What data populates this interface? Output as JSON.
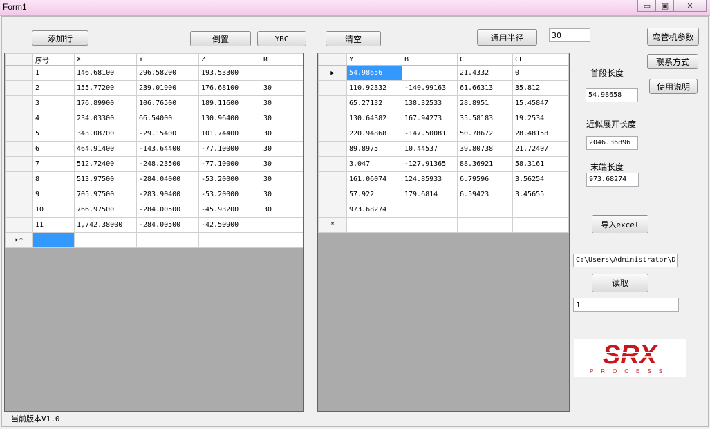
{
  "window": {
    "title": "Form1",
    "minimize": "▭",
    "maximize": "▣",
    "close": "✕"
  },
  "toolbar": {
    "add_row": "添加行",
    "invert": "倒置",
    "ybc": "YBC",
    "clear": "清空",
    "common_radius": "通用半径",
    "radius_value": "30"
  },
  "side": {
    "bender_params": "弯管机参数",
    "contact": "联系方式",
    "instructions": "使用说明",
    "first_length_label": "首段长度",
    "first_length_value": "54.98658",
    "approx_unfold_label": "近似展开长度",
    "approx_unfold_value": "2046.36896",
    "end_length_label": "末端长度",
    "end_length_value": "973.68274",
    "import_excel": "导入excel",
    "path_value": "C:\\Users\\Administrator\\D",
    "read": "读取",
    "read_value": "1"
  },
  "grid1": {
    "columns": [
      "序号",
      "X",
      "Y",
      "Z",
      "R"
    ],
    "rows": [
      [
        "1",
        "146.68100",
        "296.58200",
        "193.53300",
        ""
      ],
      [
        "2",
        "155.77200",
        "239.01900",
        "176.68100",
        "30"
      ],
      [
        "3",
        "176.89900",
        "106.76500",
        "189.11600",
        "30"
      ],
      [
        "4",
        "234.03300",
        "66.54000",
        "130.96400",
        "30"
      ],
      [
        "5",
        "343.08700",
        "-29.15400",
        "101.74400",
        "30"
      ],
      [
        "6",
        "464.91400",
        "-143.64400",
        "-77.10000",
        "30"
      ],
      [
        "7",
        "512.72400",
        "-248.23500",
        "-77.10000",
        "30"
      ],
      [
        "8",
        "513.97500",
        "-284.04000",
        "-53.20000",
        "30"
      ],
      [
        "9",
        "705.97500",
        "-283.90400",
        "-53.20000",
        "30"
      ],
      [
        "10",
        "766.97500",
        "-284.00500",
        "-45.93200",
        "30"
      ],
      [
        "11",
        "1,742.38000",
        "-284.00500",
        "-42.50900",
        ""
      ]
    ],
    "new_row_marker": "▸*"
  },
  "grid2": {
    "columns": [
      "Y",
      "B",
      "C",
      "CL"
    ],
    "rows": [
      [
        "54.98656",
        "",
        "21.4332",
        "0"
      ],
      [
        "110.92332",
        "-140.99163",
        "61.66313",
        "35.812"
      ],
      [
        "65.27132",
        "138.32533",
        "28.8951",
        "15.45847"
      ],
      [
        "130.64382",
        "167.94273",
        "35.58183",
        "19.2534"
      ],
      [
        "220.94868",
        "-147.50081",
        "50.78672",
        "28.48158"
      ],
      [
        "89.8975",
        "10.44537",
        "39.80738",
        "21.72407"
      ],
      [
        "3.047",
        "-127.91365",
        "88.36921",
        "58.3161"
      ],
      [
        "161.06074",
        "124.85933",
        "6.79596",
        "3.56254"
      ],
      [
        "57.922",
        "179.6814",
        "6.59423",
        "3.45655"
      ],
      [
        "973.68274",
        "",
        "",
        ""
      ]
    ],
    "current_marker": "▶",
    "new_row_marker": "*"
  },
  "logo": {
    "brand": "SRX",
    "sub": "PROCESS"
  },
  "status": {
    "version": "当前版本V1.0"
  }
}
